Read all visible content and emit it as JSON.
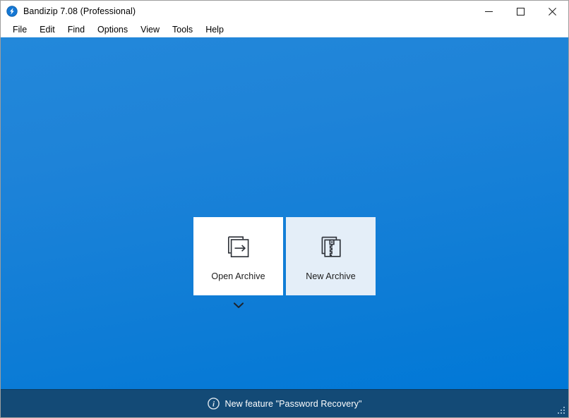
{
  "window": {
    "title": "Bandizip 7.08 (Professional)",
    "app_icon": "bandizip-logo-icon",
    "controls": [
      {
        "name": "minimize",
        "glyph": "minimize-icon",
        "label": "Minimize"
      },
      {
        "name": "maximize",
        "glyph": "maximize-icon",
        "label": "Maximize"
      },
      {
        "name": "close",
        "glyph": "close-icon",
        "label": "Close"
      }
    ]
  },
  "menubar": {
    "items": [
      {
        "label": "File"
      },
      {
        "label": "Edit"
      },
      {
        "label": "Find"
      },
      {
        "label": "Options"
      },
      {
        "label": "View"
      },
      {
        "label": "Tools"
      },
      {
        "label": "Help"
      }
    ]
  },
  "main": {
    "cards": [
      {
        "label": "Open Archive",
        "icon": "open-archive-icon"
      },
      {
        "label": "New Archive",
        "icon": "new-archive-icon"
      }
    ],
    "expander_icon": "chevron-down-icon"
  },
  "statusbar": {
    "icon": "info-icon",
    "message": "New feature \"Password Recovery\"",
    "resize_grip": "resize-grip-icon"
  },
  "colors": {
    "canvas_top": "#2388da",
    "canvas_bottom": "#0078d7",
    "card_open_bg": "#ffffff",
    "card_new_bg": "#e4eef8",
    "statusbar_bg": "#134a76",
    "accent": "#0078d7",
    "icon_stroke": "#2b2f36"
  }
}
